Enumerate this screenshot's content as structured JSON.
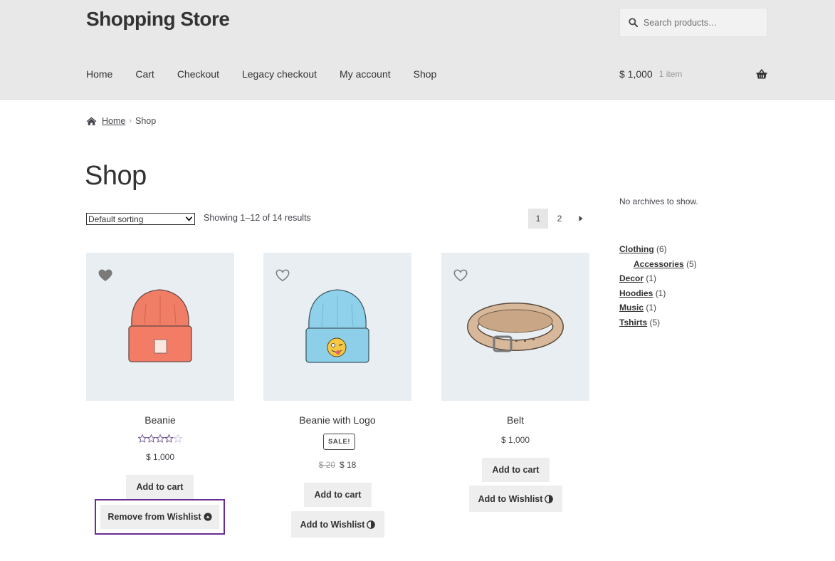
{
  "site": {
    "title": "Shopping Store"
  },
  "search": {
    "placeholder": "Search products…"
  },
  "nav": {
    "items": [
      "Home",
      "Cart",
      "Checkout",
      "Legacy checkout",
      "My account",
      "Shop"
    ]
  },
  "cart": {
    "amount": "$ 1,000",
    "count": "1 item",
    "icon": "basket-icon"
  },
  "breadcrumb": {
    "home": "Home",
    "current": "Shop"
  },
  "page": {
    "title": "Shop"
  },
  "sorting": {
    "selected": "Default sorting"
  },
  "results": {
    "text": "Showing 1–12 of 14 results"
  },
  "pagination": {
    "pages": [
      "1",
      "2"
    ],
    "current": "1"
  },
  "products": [
    {
      "name": "Beanie",
      "rating": 3.5,
      "rating_max": 5,
      "price": "$ 1,000",
      "add_to_cart": "Add to cart",
      "wishlist_label": "Remove from Wishlist",
      "in_wishlist": true
    },
    {
      "name": "Beanie with Logo",
      "badge": "SALE!",
      "old_price": "$ 20",
      "price": "$ 18",
      "add_to_cart": "Add to cart",
      "wishlist_label": "Add to Wishlist",
      "in_wishlist": false
    },
    {
      "name": "Belt",
      "price": "$ 1,000",
      "add_to_cart": "Add to cart",
      "wishlist_label": "Add to Wishlist",
      "in_wishlist": false
    }
  ],
  "sidebar": {
    "archives_text": "No archives to show.",
    "categories": [
      {
        "name": "Clothing",
        "count": "(6)",
        "level": 0
      },
      {
        "name": "Accessories",
        "count": "(5)",
        "level": 1
      },
      {
        "name": "Decor",
        "count": "(1)",
        "level": 0
      },
      {
        "name": "Hoodies",
        "count": "(1)",
        "level": 0
      },
      {
        "name": "Music",
        "count": "(1)",
        "level": 0
      },
      {
        "name": "Tshirts",
        "count": "(5)",
        "level": 0
      }
    ]
  },
  "colors": {
    "header_bg": "#e8e8e8",
    "image_bg": "#e8eef2",
    "highlight": "#6a2c91",
    "star": "#6a4c8c",
    "button_bg": "#eeeeee"
  }
}
